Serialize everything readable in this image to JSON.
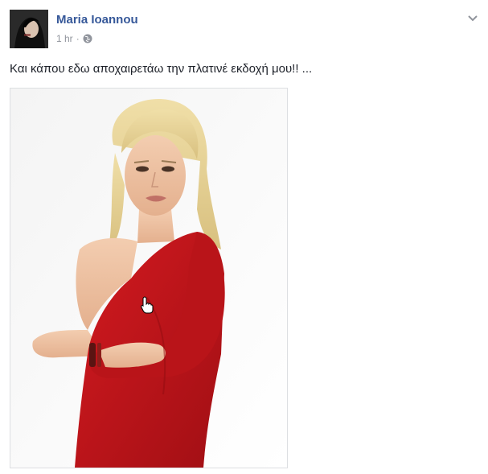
{
  "post": {
    "author": "Maria Ioannou",
    "time": "1 hr",
    "separator": "·",
    "audience_icon": "globe-icon",
    "options_icon": "chevron-down-icon",
    "text": "Και κάπου εδω αποχαιρετάω την πλατινέ εκδοχή μου!! ...",
    "photo": {
      "subject": "woman with platinum blonde hair in a red one-shoulder dress, arms crossed"
    }
  },
  "colors": {
    "author_link": "#365899",
    "meta_text": "#90949c",
    "body_text": "#1d2129",
    "dress": "#c4161c",
    "hair": "#e8d49a"
  }
}
